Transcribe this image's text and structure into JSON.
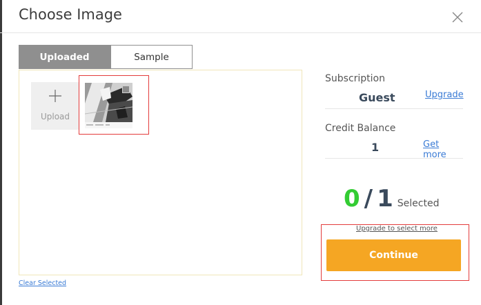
{
  "dialog": {
    "title": "Choose Image"
  },
  "tabs": [
    {
      "label": "Uploaded",
      "active": true
    },
    {
      "label": "Sample",
      "active": false
    }
  ],
  "gallery": {
    "upload_label": "Upload",
    "clear_link": "Clear Selected",
    "thumbnail": {
      "checked": false
    }
  },
  "side": {
    "subscription_label": "Subscription",
    "subscription_value": "Guest",
    "upgrade_link": "Upgrade",
    "credit_label": "Credit Balance",
    "credit_value": "1",
    "get_more_link": "Get more",
    "selected_count": "0",
    "selected_total": "1",
    "selected_sep": "/",
    "selected_label": "Selected",
    "upgrade_more_link": "Upgrade to select more",
    "continue_label": "Continue"
  },
  "colors": {
    "accent": "#f5a623",
    "count_green": "#33cc33",
    "link": "#3a7bd5",
    "highlight": "#e33b3b"
  },
  "icons": {
    "close": "close-icon",
    "upload": "plus-icon"
  }
}
